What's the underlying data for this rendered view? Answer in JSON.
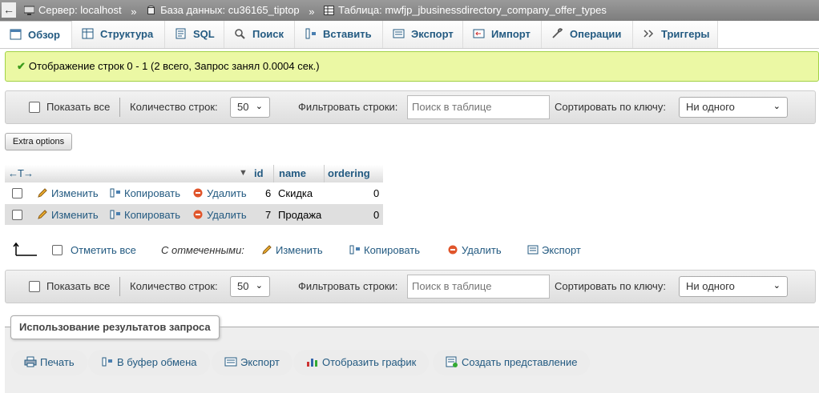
{
  "breadcrumb": {
    "back_glyph": "←",
    "items": [
      {
        "label": "Сервер: localhost",
        "icon": "server-icon"
      },
      {
        "label": "База данных: cu36165_tiptop",
        "icon": "database-icon"
      },
      {
        "label": "Таблица: mwfjp_jbusinessdirectory_company_offer_types",
        "icon": "table-icon"
      }
    ],
    "separator": "»"
  },
  "tabs": [
    {
      "label": "Обзор",
      "icon": "browse-icon",
      "active": true
    },
    {
      "label": "Структура",
      "icon": "structure-icon"
    },
    {
      "label": "SQL",
      "icon": "sql-icon"
    },
    {
      "label": "Поиск",
      "icon": "search-icon"
    },
    {
      "label": "Вставить",
      "icon": "insert-icon"
    },
    {
      "label": "Экспорт",
      "icon": "export-icon"
    },
    {
      "label": "Импорт",
      "icon": "import-icon"
    },
    {
      "label": "Операции",
      "icon": "operations-icon"
    },
    {
      "label": "Триггеры",
      "icon": "triggers-icon"
    }
  ],
  "success_message": "Отображение строк 0 - 1 (2 всего, Запрос занял 0.0004 сек.)",
  "nav": {
    "show_all": "Показать все",
    "rows_count_label": "Количество строк:",
    "rows_count_value": "50",
    "filter_label": "Фильтровать строки:",
    "filter_placeholder": "Поиск в таблице",
    "sort_label": "Сортировать по ключу:",
    "sort_value": "Ни одного"
  },
  "extra_options": "Extra options",
  "table": {
    "arrows": "←T→",
    "columns": [
      "id",
      "name",
      "ordering"
    ],
    "row_actions": {
      "edit": "Изменить",
      "copy": "Копировать",
      "delete": "Удалить"
    },
    "rows": [
      {
        "id": "6",
        "name": "Скидка",
        "ordering": "0"
      },
      {
        "id": "7",
        "name": "Продажа",
        "ordering": "0"
      }
    ]
  },
  "bulk": {
    "check_all": "Отметить все",
    "with_selected": "С отмеченными:",
    "edit": "Изменить",
    "copy": "Копировать",
    "delete": "Удалить",
    "export": "Экспорт"
  },
  "query_results": {
    "legend": "Использование результатов запроса",
    "buttons": [
      "Печать",
      "В буфер обмена",
      "Экспорт",
      "Отобразить график",
      "Создать представление"
    ]
  },
  "colors": {
    "link": "#235a81",
    "success_bg": "#ebf8a4",
    "success_border": "#a2d246"
  }
}
